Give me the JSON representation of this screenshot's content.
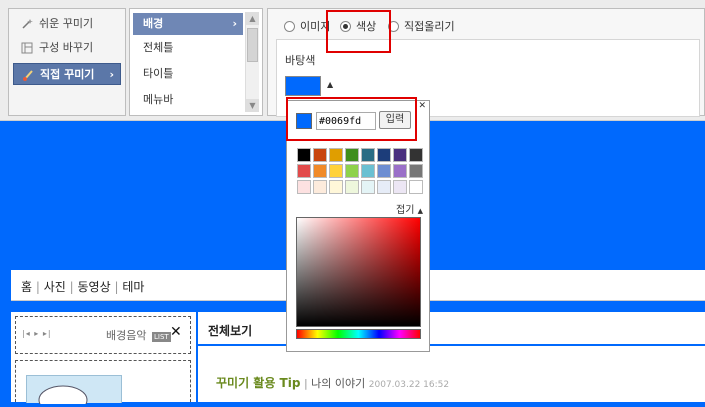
{
  "modes": [
    {
      "label": "쉬운 꾸미기",
      "icon": "magic-wand-icon"
    },
    {
      "label": "구성 바꾸기",
      "icon": "layout-icon"
    },
    {
      "label": "직접 꾸미기",
      "icon": "brush-icon",
      "active": true
    }
  ],
  "categories": [
    "배경",
    "전체틀",
    "타이틀",
    "메뉴바"
  ],
  "bg_options": {
    "radio": [
      "이미지",
      "색상",
      "직접올리기"
    ],
    "selected": "색상",
    "field_label": "바탕색",
    "current_color": "#0069fd"
  },
  "picker": {
    "hex_value": "#0069fd",
    "apply_label": "입력",
    "collapse_label": "접기",
    "swatches": [
      "#000000",
      "#c8440c",
      "#e09e00",
      "#3e8e1c",
      "#2a6d84",
      "#1c3d7a",
      "#4a2f7e",
      "#333333",
      "#e24b4b",
      "#f08a28",
      "#ffd23a",
      "#8ed24b",
      "#6ac0d2",
      "#6d8ed2",
      "#9a70c8",
      "#777777",
      "#fde1e1",
      "#fdebdc",
      "#fff7d9",
      "#eef7dc",
      "#e4f4f6",
      "#e6ecf7",
      "#ece6f4",
      "#ffffff"
    ]
  },
  "nav": [
    "홈",
    "사진",
    "동영상",
    "테마"
  ],
  "sidebar_widget": {
    "label": "배경음악",
    "badge": "LIST"
  },
  "main": {
    "heading": "전체보기",
    "post_title": "꾸미기 활용 Tip",
    "post_category": "나의 이야기",
    "post_date": "2007.03.22 16:52"
  }
}
